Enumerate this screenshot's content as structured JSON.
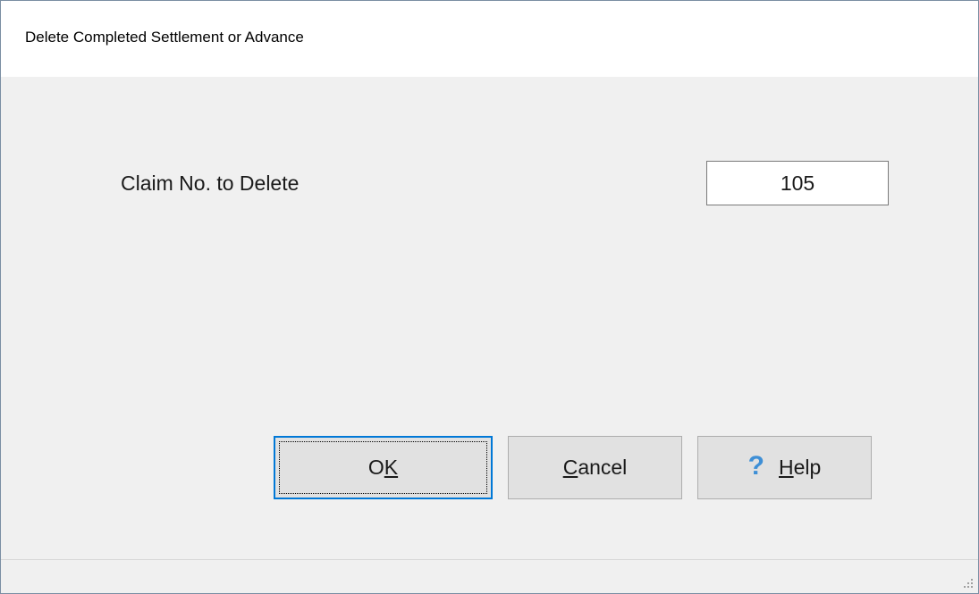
{
  "window": {
    "title": "Delete Completed Settlement or Advance"
  },
  "form": {
    "claim_label": "Claim No. to Delete",
    "claim_value": "105"
  },
  "buttons": {
    "ok_mnemonic_pre": "O",
    "ok_mnemonic_key": "K",
    "cancel_mnemonic_key": "C",
    "cancel_rest": "ancel",
    "help_mnemonic_key": "H",
    "help_rest": "elp",
    "help_icon_glyph": "?"
  },
  "icons": {
    "help": "question-mark-icon",
    "resize": "resize-grip-icon"
  },
  "colors": {
    "focus_border": "#0078d7",
    "help_icon": "#3e8fd6",
    "dialog_background": "#f0f0f0"
  }
}
